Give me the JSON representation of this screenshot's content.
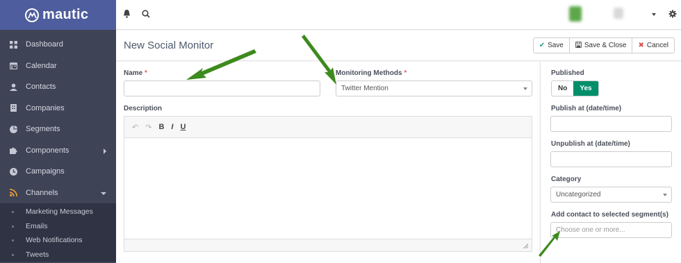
{
  "brand": {
    "name": "mautic"
  },
  "sidebar": {
    "items": [
      {
        "label": "Dashboard",
        "icon": "dashboard-icon"
      },
      {
        "label": "Calendar",
        "icon": "calendar-icon"
      },
      {
        "label": "Contacts",
        "icon": "user-icon"
      },
      {
        "label": "Companies",
        "icon": "building-icon"
      },
      {
        "label": "Segments",
        "icon": "pie-chart-icon"
      },
      {
        "label": "Components",
        "icon": "puzzle-icon"
      },
      {
        "label": "Campaigns",
        "icon": "clock-icon"
      },
      {
        "label": "Channels",
        "icon": "rss-icon"
      }
    ],
    "subitems": [
      "Marketing Messages",
      "Emails",
      "Web Notifications",
      "Tweets"
    ]
  },
  "page": {
    "title": "New Social Monitor"
  },
  "toolbar": {
    "save": "Save",
    "save_close": "Save & Close",
    "cancel": "Cancel"
  },
  "form": {
    "name_label": "Name",
    "name_value": "",
    "methods_label": "Monitoring Methods",
    "methods_value": "Twitter Mention",
    "required_mark": "*",
    "description_label": "Description",
    "editor": {
      "bold": "B",
      "italic": "I",
      "underline": "U"
    }
  },
  "side": {
    "published_label": "Published",
    "no": "No",
    "yes": "Yes",
    "publish_at_label": "Publish at (date/time)",
    "unpublish_at_label": "Unpublish at (date/time)",
    "category_label": "Category",
    "category_value": "Uncategorized",
    "segments_label": "Add contact to selected segment(s)",
    "segments_placeholder": "Choose one or more..."
  },
  "colors": {
    "sidebar": "#3e4355",
    "logo_bg": "#4e5d9d",
    "yes_active": "#008f6b",
    "arrow": "#3d8a1e"
  }
}
